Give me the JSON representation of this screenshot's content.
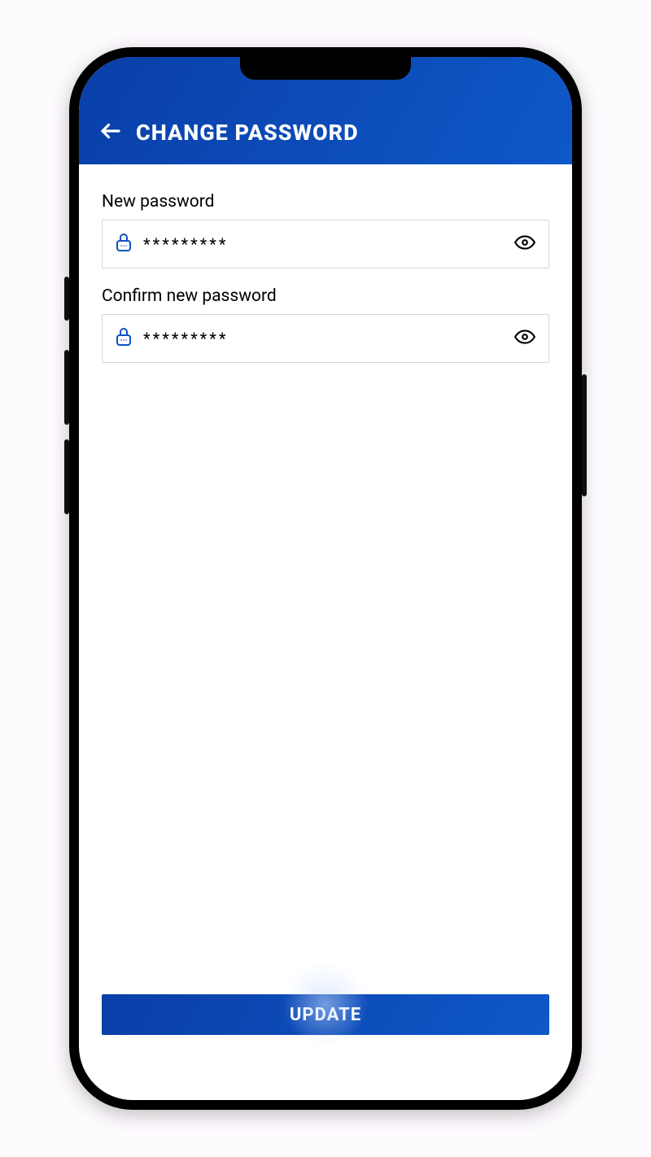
{
  "header": {
    "title": "CHANGE PASSWORD"
  },
  "form": {
    "newPassword": {
      "label": "New password",
      "value": "*********"
    },
    "confirmPassword": {
      "label": "Confirm new password",
      "value": "*********"
    }
  },
  "actions": {
    "updateLabel": "UPDATE"
  },
  "colors": {
    "headerGradientStart": "#0A3FA8",
    "headerGradientEnd": "#0E58C8",
    "brandBlue": "#0C52C2",
    "fieldBorder": "#D6D6D6"
  }
}
